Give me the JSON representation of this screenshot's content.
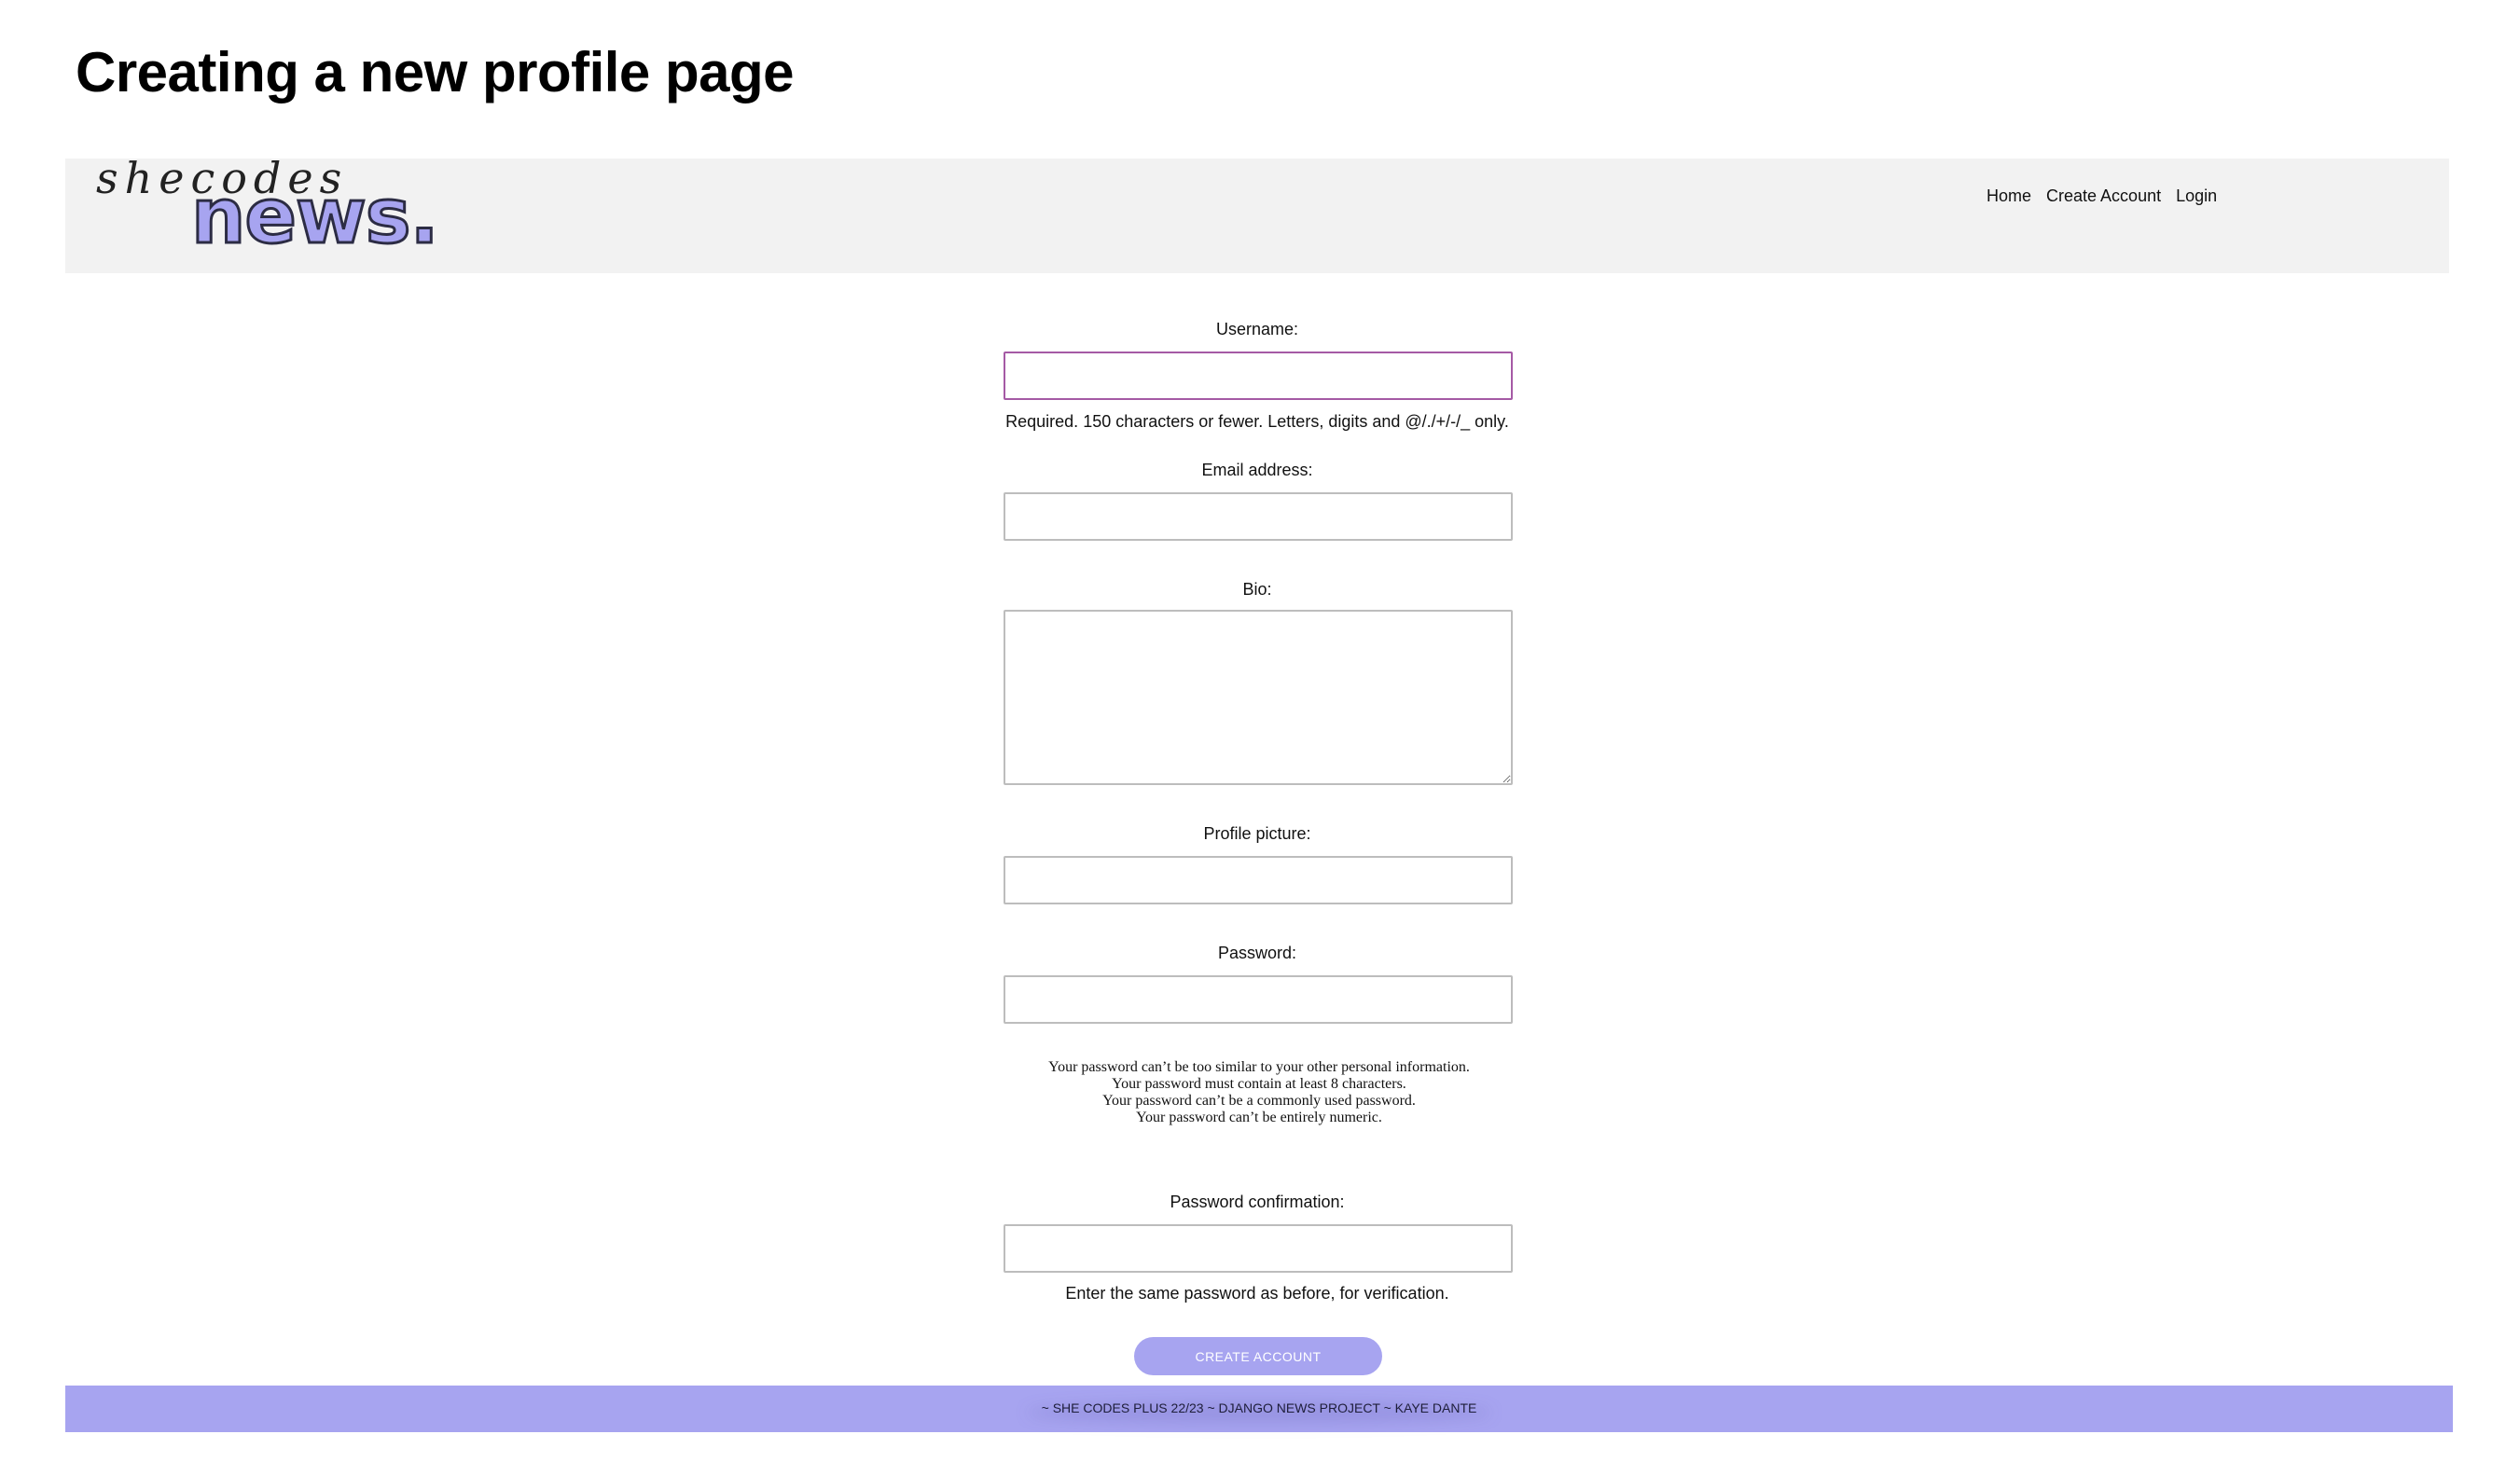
{
  "slide": {
    "title": "Creating a new profile page"
  },
  "brand": {
    "script": "shecodes",
    "word": "news."
  },
  "nav": {
    "items": [
      {
        "label": "Home"
      },
      {
        "label": "Create Account"
      },
      {
        "label": "Login"
      }
    ]
  },
  "form": {
    "username": {
      "label": "Username:",
      "value": "",
      "help": "Required. 150 characters or fewer. Letters, digits and @/./+/-/_ only."
    },
    "email": {
      "label": "Email address:",
      "value": ""
    },
    "bio": {
      "label": "Bio:",
      "value": ""
    },
    "profile_picture": {
      "label": "Profile picture:",
      "value": ""
    },
    "password": {
      "label": "Password:",
      "value": "",
      "rules": [
        "Your password can’t be too similar to your other personal information.",
        "Your password must contain at least 8 characters.",
        "Your password can’t be a commonly used password.",
        "Your password can’t be entirely numeric."
      ]
    },
    "password_confirmation": {
      "label": "Password confirmation:",
      "value": "",
      "help": "Enter the same password as before, for verification."
    },
    "submit_label": "CREATE ACCOUNT"
  },
  "footer": {
    "text": "~ SHE CODES PLUS 22/23 ~ DJANGO NEWS PROJECT ~ KAYE DANTE"
  },
  "colors": {
    "accent": "#a7a4f0",
    "navbar_bg": "#f2f2f2",
    "focus_border": "#a55aa5"
  }
}
